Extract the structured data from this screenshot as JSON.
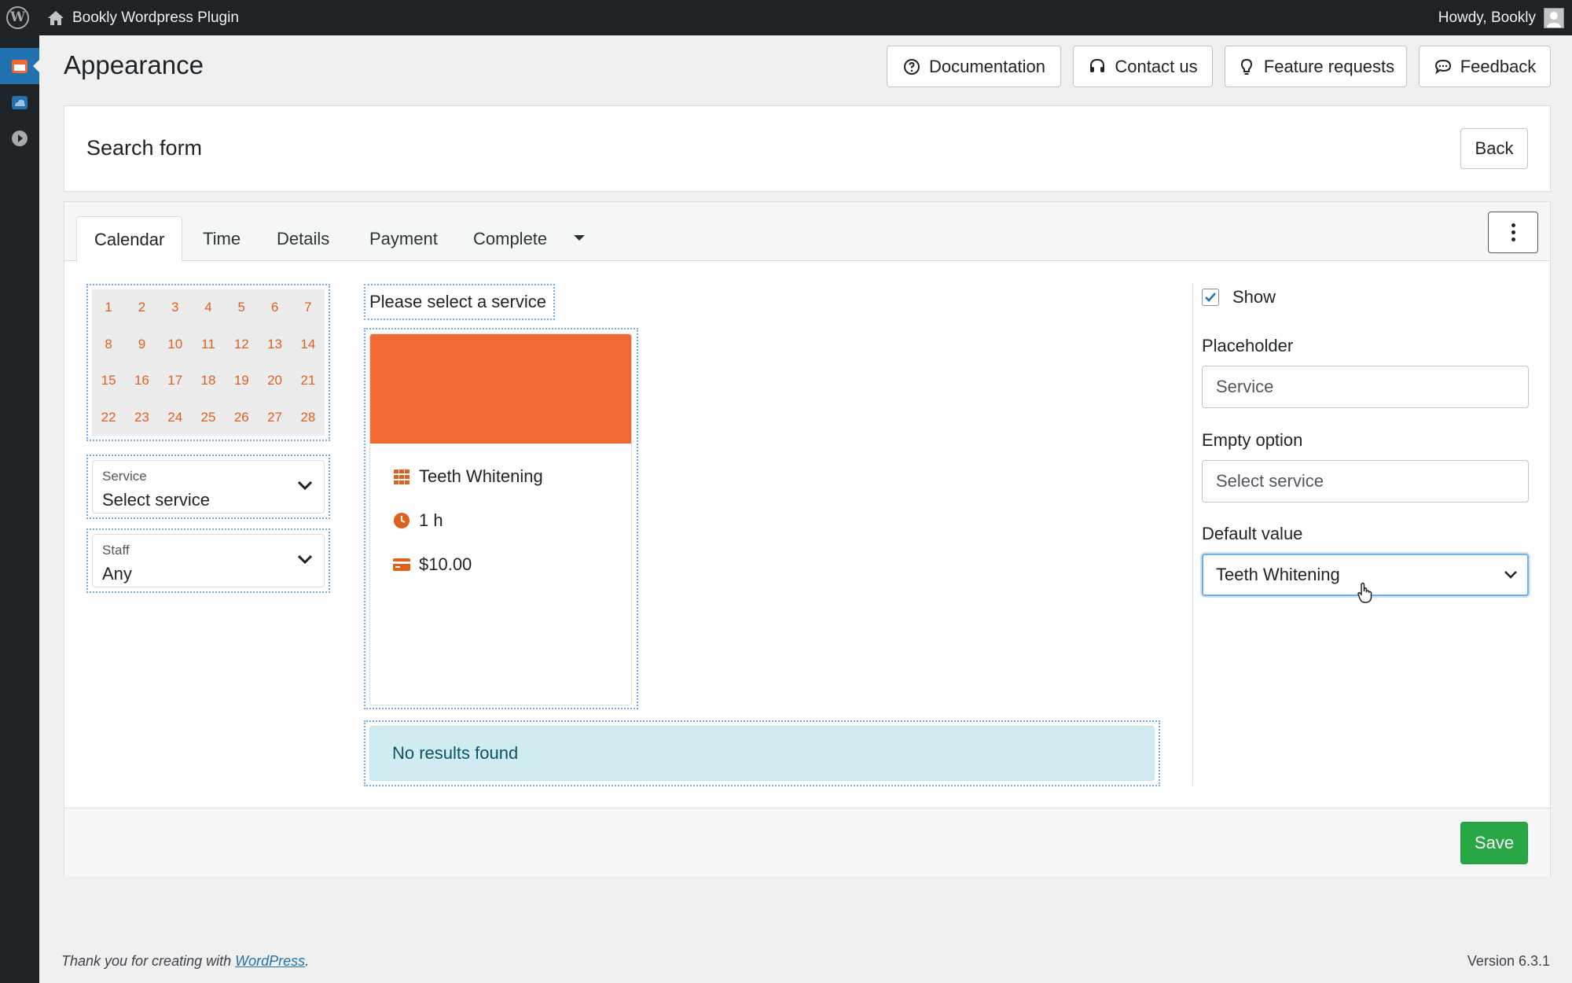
{
  "admin_bar": {
    "wp_logo_glyph": "W",
    "site_name": "Bookly Wordpress Plugin",
    "greeting": "Howdy, Bookly"
  },
  "admin_menu": {
    "icons": [
      "bookly-calendar-icon",
      "cloud-icon",
      "play-icon"
    ],
    "accent": "#2271b1"
  },
  "header": {
    "title": "Appearance",
    "buttons": {
      "documentation": "Documentation",
      "contact": "Contact us",
      "feature_requests": "Feature requests",
      "feedback": "Feedback"
    }
  },
  "search_form": {
    "title": "Search form",
    "back_label": "Back"
  },
  "tabs": {
    "calendar": "Calendar",
    "time": "Time",
    "details": "Details",
    "payment": "Payment",
    "complete": "Complete"
  },
  "calendar": {
    "days": [
      "1",
      "2",
      "3",
      "4",
      "5",
      "6",
      "7",
      "8",
      "9",
      "10",
      "11",
      "12",
      "13",
      "14",
      "15",
      "16",
      "17",
      "18",
      "19",
      "20",
      "21",
      "22",
      "23",
      "24",
      "25",
      "26",
      "27",
      "28"
    ],
    "day_color": "#e0601f"
  },
  "filters": {
    "service": {
      "label": "Service",
      "value": "Select service"
    },
    "staff": {
      "label": "Staff",
      "value": "Any"
    }
  },
  "preview": {
    "prompt": "Please select a service",
    "service_card": {
      "name": "Teeth Whitening",
      "duration": "1 h",
      "price": "$10.00",
      "banner_color": "#f26a33"
    },
    "no_results": "No results found"
  },
  "settings": {
    "show_label": "Show",
    "show_checked": true,
    "placeholder_label": "Placeholder",
    "placeholder_value": "Service",
    "empty_option_label": "Empty option",
    "empty_option_value": "Select service",
    "default_value_label": "Default value",
    "default_value": "Teeth Whitening"
  },
  "save_label": "Save",
  "footer": {
    "thanks_prefix": "Thank you for creating with ",
    "link": "WordPress",
    "suffix": ".",
    "version": "Version 6.3.1"
  }
}
